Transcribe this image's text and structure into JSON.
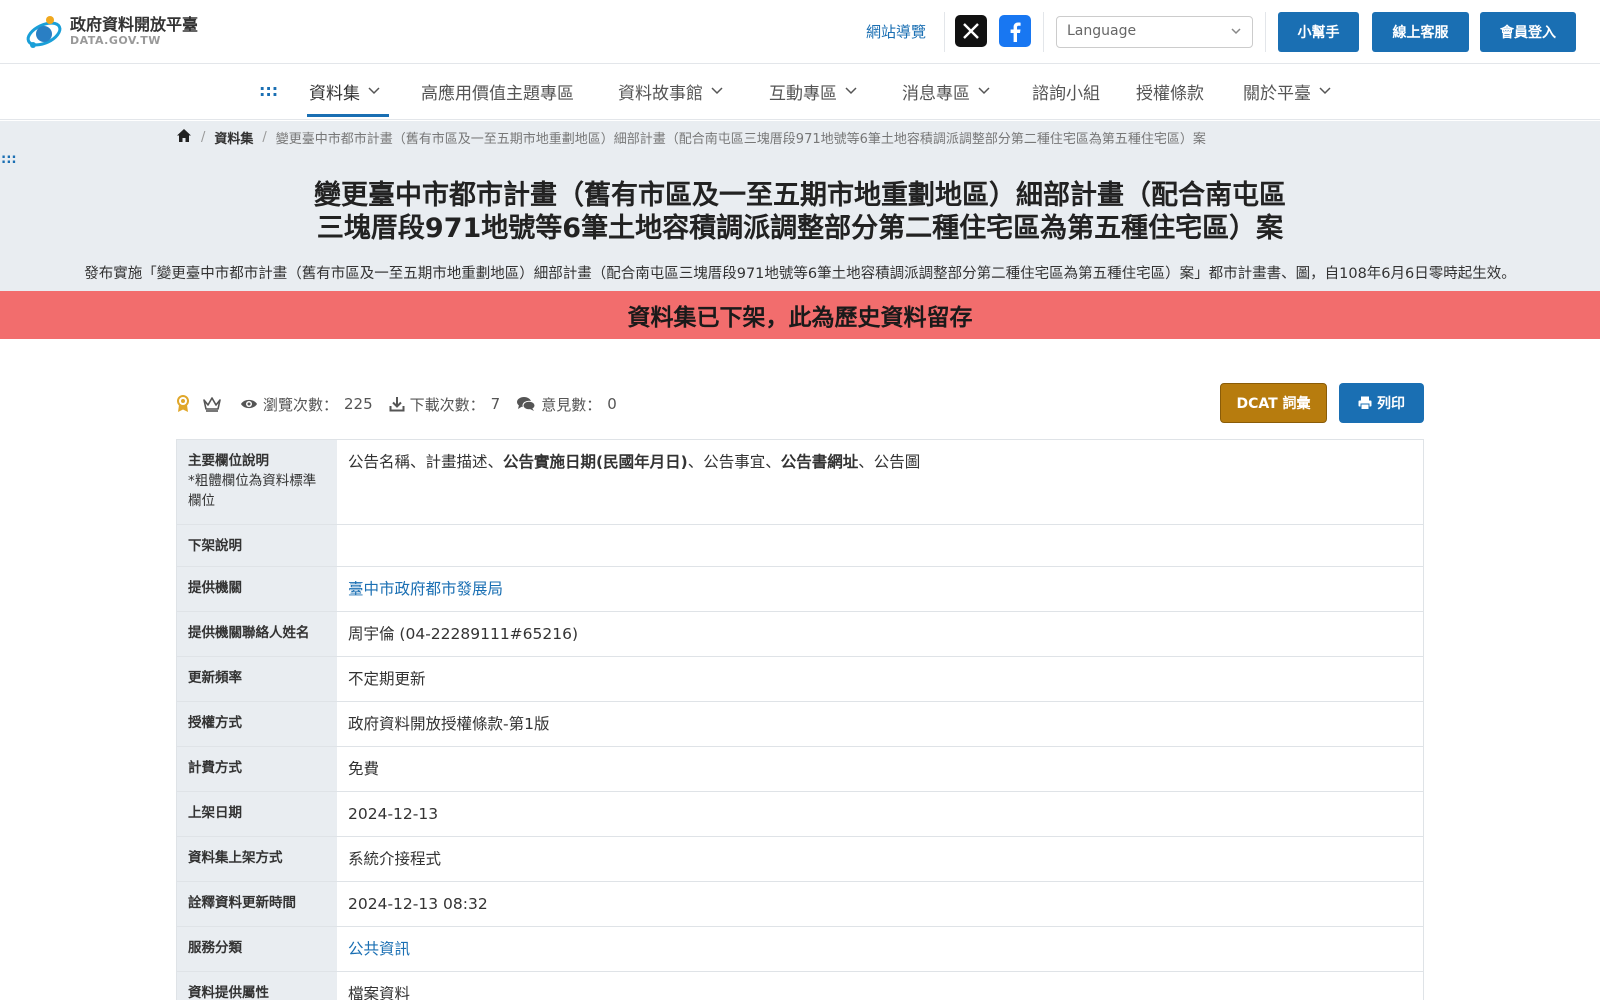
{
  "header": {
    "logo_title": "政府資料開放平臺",
    "logo_sub": "DATA.GOV.TW",
    "site_map": "網站導覽",
    "language_placeholder": "Language",
    "helper": "小幫手",
    "online_service": "線上客服",
    "member_login": "會員登入",
    "x_icon": "x-icon",
    "facebook_icon": "facebook-icon"
  },
  "nav": {
    "dots": ":::",
    "items": [
      {
        "label": "資料集"
      },
      {
        "label": "高應用價值主題專區"
      },
      {
        "label": "資料故事館"
      },
      {
        "label": "互動專區"
      },
      {
        "label": "消息專區"
      },
      {
        "label": "諮詢小組"
      },
      {
        "label": "授權條款"
      },
      {
        "label": "關於平臺"
      }
    ]
  },
  "breadcrumb": {
    "dataset": "資料集",
    "current": "變更臺中市都市計畫（舊有市區及一至五期市地重劃地區）細部計畫（配合南屯區三塊厝段971地號等6筆土地容積調派調整部分第二種住宅區為第五種住宅區）案"
  },
  "page": {
    "left_dots": ":::",
    "title_line1": "變更臺中市都市計畫（舊有市區及一至五期市地重劃地區）細部計畫（配合南屯區",
    "title_line2": "三塊厝段971地號等6筆土地容積調派調整部分第二種住宅區為第五種住宅區）案",
    "description": "發布實施「變更臺中市都市計畫（舊有市區及一至五期市地重劃地區）細部計畫（配合南屯區三塊厝段971地號等6筆土地容積調派調整部分第二種住宅區為第五種住宅區）案」都市計畫書、圖，自108年6月6日零時起生效。",
    "alert": "資料集已下架，此為歷史資料留存"
  },
  "stats": {
    "views_label": "瀏覽次數：",
    "views": "225",
    "downloads_label": "下載次數：",
    "downloads": "7",
    "comments_label": "意見數：",
    "comments": "0"
  },
  "actions": {
    "dcat": "DCAT 詞彙",
    "print": "列印"
  },
  "meta": {
    "main_fields_key": "主要欄位說明",
    "main_fields_note": "*粗體欄位為資料標準欄位",
    "main_fields_parts": [
      "公告名稱、計畫描述、",
      "公告實施日期(民國年月日)",
      "、公告事宜、",
      "公告書網址",
      "、公告圖"
    ],
    "delisted_key": "下架說明",
    "delisted_val": "",
    "provider_key": "提供機關",
    "provider_val": "臺中市政府都市發展局",
    "contact_key": "提供機關聯絡人姓名",
    "contact_val": "周宇倫 (04-22289111#65216)",
    "freq_key": "更新頻率",
    "freq_val": "不定期更新",
    "license_key": "授權方式",
    "license_val": "政府資料開放授權條款-第1版",
    "fee_key": "計費方式",
    "fee_val": "免費",
    "onshelf_key": "上架日期",
    "onshelf_val": "2024-12-13",
    "method_key": "資料集上架方式",
    "method_val": "系統介接程式",
    "updated_key": "詮釋資料更新時間",
    "updated_val": "2024-12-13 08:32",
    "category_key": "服務分類",
    "category_val": "公共資訊",
    "attr_key": "資料提供屬性",
    "attr_val": "檔案資料"
  }
}
